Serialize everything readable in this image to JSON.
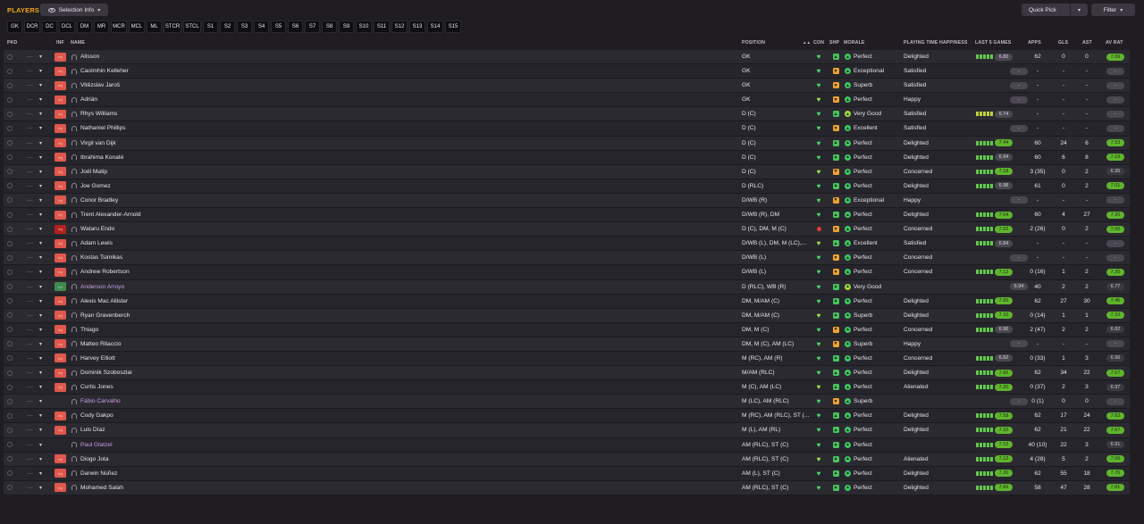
{
  "header": {
    "title": "PLAYERS",
    "selection_info_label": "Selection Info",
    "quick_pick_label": "Quick Pick",
    "filter_label": "Filter"
  },
  "tabs": [
    "GK",
    "DCR",
    "DC",
    "DCL",
    "DM",
    "MR",
    "MCR",
    "MCL",
    "ML",
    "STCR",
    "STCL",
    "S1",
    "S2",
    "S3",
    "S4",
    "S5",
    "S6",
    "S7",
    "S8",
    "S9",
    "S10",
    "S11",
    "S12",
    "S13",
    "S14",
    "S15"
  ],
  "columns": {
    "pkd": "PKD",
    "inf": "INF",
    "name": "NAME",
    "position": "POSITION",
    "sort": "▲▲",
    "con": "CON",
    "shp": "SHP",
    "morale": "MORALE",
    "happiness": "PLAYING TIME HAPPINESS",
    "last5": "LAST 5 GAMES",
    "apps": "APPS",
    "gls": "GLS",
    "ast": "AST",
    "avr": "AV RAT"
  },
  "colors": {
    "title": "#f3a51c",
    "injury_badge": "#e0574c",
    "rating_green": "#5fb52d",
    "other_player": "#c89fe6"
  },
  "rows": [
    {
      "inf": "Inj",
      "name": "Alisson",
      "pos": "GK",
      "shp": "g",
      "morale": "Perfect",
      "mi": "a",
      "hap": "Delighted",
      "l5": "ggggg",
      "l5r": "6.80",
      "l5c": "grey",
      "apps": "62",
      "gls": "0",
      "ast": "0",
      "avr": "7.09",
      "avrc": "green"
    },
    {
      "inf": "Inj",
      "name": "Caoimhin Kelleher",
      "pos": "GK",
      "shp": "o",
      "morale": "Exceptional",
      "mi": "a",
      "hap": "Satisfied",
      "l5": "",
      "l5r": "-",
      "l5c": "grey",
      "apps": "-",
      "gls": "-",
      "ast": "-",
      "avr": "-",
      "avrc": "grey"
    },
    {
      "inf": "Inj",
      "name": "Vitězslav Jaroš",
      "pos": "GK",
      "shp": "o",
      "morale": "Superb",
      "mi": "a",
      "hap": "Satisfied",
      "l5": "",
      "l5r": "-",
      "l5c": "grey",
      "apps": "-",
      "gls": "-",
      "ast": "-",
      "avr": "-",
      "avrc": "grey"
    },
    {
      "inf": "Inj",
      "name": "Adrián",
      "pos": "GK",
      "shp": "o",
      "morale": "Perfect",
      "mi": "a",
      "hap": "Happy",
      "l5": "",
      "l5r": "-",
      "l5c": "grey",
      "apps": "-",
      "gls": "-",
      "ast": "-",
      "avr": "-",
      "avrc": "grey"
    },
    {
      "inf": "Inj",
      "name": "Rhys Williams",
      "pos": "D (C)",
      "shp": "g",
      "morale": "Very Good",
      "mi": "b",
      "hap": "Satisfied",
      "l5": "yyyyy",
      "l5r": "6.74",
      "l5c": "grey",
      "apps": "-",
      "gls": "-",
      "ast": "-",
      "avr": "-",
      "avrc": "grey"
    },
    {
      "inf": "Inj",
      "name": "Nathaniel Phillips",
      "pos": "D (C)",
      "shp": "o",
      "morale": "Excellent",
      "mi": "a",
      "hap": "Satisfied",
      "l5": "",
      "l5r": "-",
      "l5c": "grey",
      "apps": "-",
      "gls": "-",
      "ast": "-",
      "avr": "-",
      "avrc": "grey"
    },
    {
      "inf": "Inj",
      "name": "Virgil van Dijk",
      "pos": "D (C)",
      "shp": "g",
      "morale": "Perfect",
      "mi": "a",
      "hap": "Delighted",
      "l5": "ggggg",
      "l5r": "7.44",
      "l5c": "green",
      "apps": "60",
      "gls": "24",
      "ast": "6",
      "avr": "7.53",
      "avrc": "green"
    },
    {
      "inf": "Inj",
      "name": "Ibrahima Konaté",
      "pos": "D (C)",
      "shp": "g",
      "morale": "Perfect",
      "mi": "a",
      "hap": "Delighted",
      "l5": "ggggg",
      "l5r": "6.94",
      "l5c": "grey",
      "apps": "60",
      "gls": "6",
      "ast": "8",
      "avr": "7.19",
      "avrc": "green"
    },
    {
      "inf": "Inj",
      "name": "Joël Matip",
      "pos": "D (C)",
      "shp": "o",
      "morale": "Perfect",
      "mi": "a",
      "hap": "Concerned",
      "l5": "ggggg",
      "l5r": "7.18",
      "l5c": "green",
      "apps": "3 (35)",
      "gls": "0",
      "ast": "2",
      "avr": "6.95",
      "avrc": "dark"
    },
    {
      "inf": "Inj",
      "name": "Joe Gomez",
      "pos": "D (RLC)",
      "shp": "g",
      "morale": "Perfect",
      "mi": "a",
      "hap": "Delighted",
      "l5": "ggggg",
      "l5r": "6.98",
      "l5c": "grey",
      "apps": "61",
      "gls": "0",
      "ast": "2",
      "avr": "7.01",
      "avrc": "green"
    },
    {
      "inf": "Inj",
      "name": "Conor Bradley",
      "pos": "D/WB (R)",
      "shp": "o",
      "morale": "Exceptional",
      "mi": "a",
      "hap": "Happy",
      "l5": "",
      "l5r": "-",
      "l5c": "grey",
      "apps": "-",
      "gls": "-",
      "ast": "-",
      "avr": "-",
      "avrc": "grey"
    },
    {
      "inf": "Inj",
      "name": "Trent Alexander-Arnold",
      "pos": "D/WB (R), DM",
      "shp": "g",
      "morale": "Perfect",
      "mi": "a",
      "hap": "Delighted",
      "l5": "ggggg",
      "l5r": "7.04",
      "l5c": "green",
      "apps": "60",
      "gls": "4",
      "ast": "27",
      "avr": "7.20",
      "avrc": "green"
    },
    {
      "inf": "Inj",
      "name": "Wataru Endo",
      "pos": "D (C), DM, M (C)",
      "shp": "o",
      "morale": "Perfect",
      "mi": "a",
      "hap": "Concerned",
      "l5": "ggggg",
      "l5r": "7.02",
      "l5c": "green",
      "apps": "2 (26)",
      "gls": "0",
      "ast": "2",
      "avr": "7.06",
      "avrc": "green",
      "injured": true
    },
    {
      "inf": "Inj",
      "name": "Adam Lewis",
      "pos": "D/WB (L), DM, M (LC),...",
      "shp": "g",
      "morale": "Excellent",
      "mi": "a",
      "hap": "Satisfied",
      "l5": "ggggg",
      "l5r": "6.84",
      "l5c": "grey",
      "apps": "-",
      "gls": "-",
      "ast": "-",
      "avr": "-",
      "avrc": "grey"
    },
    {
      "inf": "Inj",
      "name": "Kostas Tsimikas",
      "pos": "D/WB (L)",
      "shp": "o",
      "morale": "Perfect",
      "mi": "a",
      "hap": "Concerned",
      "l5": "",
      "l5r": "-",
      "l5c": "grey",
      "apps": "-",
      "gls": "-",
      "ast": "-",
      "avr": "-",
      "avrc": "grey"
    },
    {
      "inf": "Inj",
      "name": "Andrew Robertson",
      "pos": "D/WB (L)",
      "shp": "o",
      "morale": "Perfect",
      "mi": "a",
      "hap": "Concerned",
      "l5": "ggggg",
      "l5r": "7.12",
      "l5c": "green",
      "apps": "0 (16)",
      "gls": "1",
      "ast": "2",
      "avr": "7.20",
      "avrc": "green"
    },
    {
      "inf": "Ln",
      "name": "Anderson Arroyo",
      "pos": "D (RLC), WB (R)",
      "shp": "g",
      "morale": "Very Good",
      "mi": "b",
      "hap": "",
      "l5": "",
      "l5r": "6.94",
      "l5c": "grey",
      "apps": "40",
      "gls": "2",
      "ast": "2",
      "avr": "6.77",
      "avrc": "dark",
      "other": true
    },
    {
      "inf": "Inj",
      "name": "Alexis Mac Allister",
      "pos": "DM, M/AM (C)",
      "shp": "g",
      "morale": "Perfect",
      "mi": "a",
      "hap": "Delighted",
      "l5": "ggggg",
      "l5r": "7.66",
      "l5c": "green",
      "apps": "62",
      "gls": "27",
      "ast": "30",
      "avr": "7.45",
      "avrc": "green"
    },
    {
      "inf": "Inj",
      "name": "Ryan Gravenberch",
      "pos": "DM, M/AM (C)",
      "shp": "g",
      "morale": "Superb",
      "mi": "a",
      "hap": "Delighted",
      "l5": "ggggg",
      "l5r": "7.10",
      "l5c": "green",
      "apps": "0 (14)",
      "gls": "1",
      "ast": "1",
      "avr": "7.10",
      "avrc": "green"
    },
    {
      "inf": "Inj",
      "name": "Thiago",
      "pos": "DM, M (C)",
      "shp": "o",
      "morale": "Perfect",
      "mi": "a",
      "hap": "Concerned",
      "l5": "ggggg",
      "l5r": "6.96",
      "l5c": "grey",
      "apps": "2 (47)",
      "gls": "2",
      "ast": "2",
      "avr": "6.82",
      "avrc": "dark"
    },
    {
      "inf": "Inj",
      "name": "Matteo Ritaccio",
      "pos": "DM, M (C), AM (LC)",
      "shp": "o",
      "morale": "Superb",
      "mi": "a",
      "hap": "Happy",
      "l5": "",
      "l5r": "-",
      "l5c": "grey",
      "apps": "-",
      "gls": "-",
      "ast": "-",
      "avr": "-",
      "avrc": "grey"
    },
    {
      "inf": "Inj",
      "name": "Harvey Elliott",
      "pos": "M (RC), AM (R)",
      "shp": "g",
      "morale": "Perfect",
      "mi": "a",
      "hap": "Concerned",
      "l5": "ggggg",
      "l5r": "6.92",
      "l5c": "grey",
      "apps": "0 (33)",
      "gls": "1",
      "ast": "3",
      "avr": "6.96",
      "avrc": "dark"
    },
    {
      "inf": "Inj",
      "name": "Dominik Szoboszlai",
      "pos": "M/AM (RLC)",
      "shp": "g",
      "morale": "Perfect",
      "mi": "a",
      "hap": "Delighted",
      "l5": "ggggg",
      "l5r": "7.66",
      "l5c": "green",
      "apps": "62",
      "gls": "34",
      "ast": "22",
      "avr": "7.57",
      "avrc": "green"
    },
    {
      "inf": "Inj",
      "name": "Curtis Jones",
      "pos": "M (C), AM (LC)",
      "shp": "g",
      "morale": "Perfect",
      "mi": "a",
      "hap": "Alienated",
      "l5": "ggggg",
      "l5r": "7.20",
      "l5c": "green",
      "apps": "0 (37)",
      "gls": "2",
      "ast": "3",
      "avr": "6.97",
      "avrc": "dark"
    },
    {
      "inf": "",
      "name": "Fábio Carvalho",
      "pos": "M (LC), AM (RLC)",
      "shp": "o",
      "morale": "Superb",
      "mi": "a",
      "hap": "",
      "l5": "",
      "l5r": "-",
      "l5c": "grey",
      "apps": "0 (1)",
      "gls": "0",
      "ast": "0",
      "avr": "-",
      "avrc": "grey",
      "other": true
    },
    {
      "inf": "Inj",
      "name": "Cody Gakpo",
      "pos": "M (RC), AM (RLC), ST (...",
      "shp": "g",
      "morale": "Perfect",
      "mi": "a",
      "hap": "Delighted",
      "l5": "ggggg",
      "l5r": "7.58",
      "l5c": "green",
      "apps": "62",
      "gls": "17",
      "ast": "24",
      "avr": "7.62",
      "avrc": "green"
    },
    {
      "inf": "Inj",
      "name": "Luis Díaz",
      "pos": "M (L), AM (RL)",
      "shp": "g",
      "morale": "Perfect",
      "mi": "a",
      "hap": "Delighted",
      "l5": "ggggg",
      "l5r": "7.32",
      "l5c": "green",
      "apps": "62",
      "gls": "21",
      "ast": "22",
      "avr": "7.67",
      "avrc": "green"
    },
    {
      "inf": "",
      "name": "Paul Glatzel",
      "pos": "AM (RLC), ST (C)",
      "shp": "g",
      "morale": "Perfect",
      "mi": "a",
      "hap": "",
      "l5": "ggggg",
      "l5r": "7.12",
      "l5c": "green",
      "apps": "40 (10)",
      "gls": "22",
      "ast": "3",
      "avr": "6.91",
      "avrc": "dark",
      "other": true
    },
    {
      "inf": "Inj",
      "name": "Diogo Jota",
      "pos": "AM (RLC), ST (C)",
      "shp": "g",
      "morale": "Perfect",
      "mi": "a",
      "hap": "Alienated",
      "l5": "ggggg",
      "l5r": "7.12",
      "l5c": "green",
      "apps": "4 (28)",
      "gls": "5",
      "ast": "2",
      "avr": "7.06",
      "avrc": "green"
    },
    {
      "inf": "Inj",
      "name": "Darwin Núñez",
      "pos": "AM (L), ST (C)",
      "shp": "g",
      "morale": "Perfect",
      "mi": "a",
      "hap": "Delighted",
      "l5": "ggggg",
      "l5r": "7.30",
      "l5c": "green",
      "apps": "62",
      "gls": "55",
      "ast": "18",
      "avr": "7.70",
      "avrc": "green"
    },
    {
      "inf": "Inj",
      "name": "Mohamed Salah",
      "pos": "AM (RLC), ST (C)",
      "shp": "g",
      "morale": "Perfect",
      "mi": "a",
      "hap": "Delighted",
      "l5": "ggggg",
      "l5r": "7.66",
      "l5c": "green",
      "apps": "58",
      "gls": "47",
      "ast": "28",
      "avr": "7.81",
      "avrc": "green"
    }
  ]
}
